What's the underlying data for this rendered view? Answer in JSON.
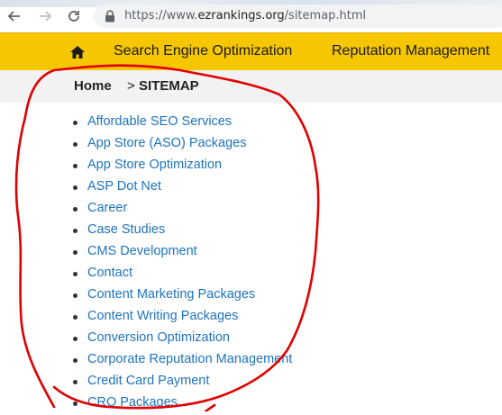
{
  "browser": {
    "url_prefix": "https://www.",
    "url_host": "ezrankings.org",
    "url_path": "/sitemap.html"
  },
  "site_nav": {
    "items": [
      {
        "label": "Search Engine Optimization"
      },
      {
        "label": "Reputation Management"
      }
    ]
  },
  "breadcrumb": {
    "home": "Home",
    "separator": ">",
    "current": "SITEMAP"
  },
  "sitemap": {
    "links": [
      "Affordable SEO Services",
      "App Store (ASO) Packages",
      "App Store Optimization",
      "ASP Dot Net",
      "Career",
      "Case Studies",
      "CMS Development",
      "Contact",
      "Content Marketing Packages",
      "Content Writing Packages",
      "Conversion Optimization",
      "Corporate Reputation Management",
      "Credit Card Payment",
      "CRO Packages"
    ]
  },
  "colors": {
    "nav_yellow": "#f6c600",
    "link_blue": "#1e73be",
    "annotation_red": "#e00000"
  }
}
